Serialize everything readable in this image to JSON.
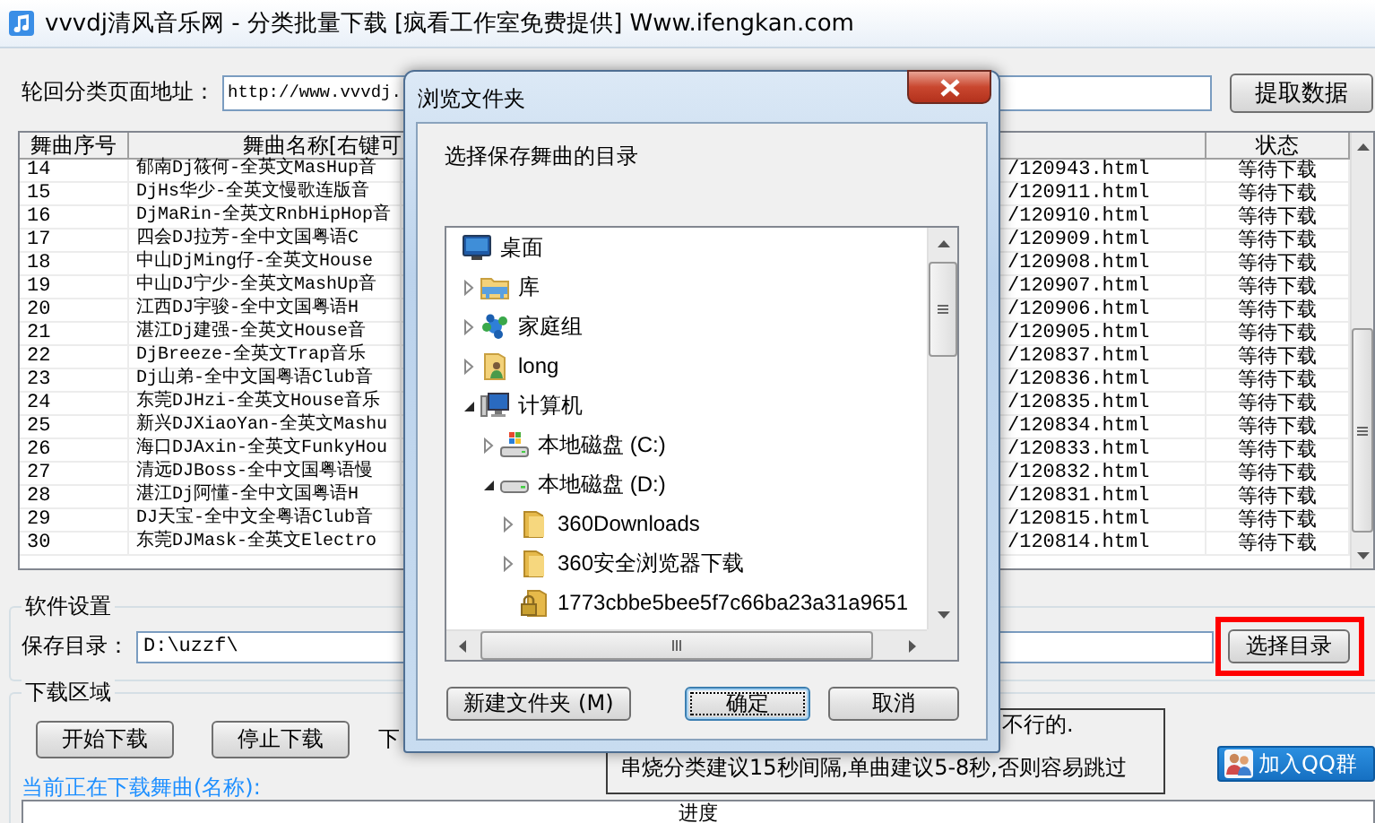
{
  "window": {
    "title": "vvvdj清风音乐网 - 分类批量下载 [疯看工作室免费提供] Www.ifengkan.com"
  },
  "url_row": {
    "label": "轮回分类页面地址：",
    "value": "http://www.vvvdj.",
    "button": "提取数据"
  },
  "song_table": {
    "columns": [
      "舞曲序号",
      "舞曲名称[右键可",
      "状态"
    ],
    "rows": [
      {
        "number": "14",
        "name": "郁南Dj筱何-全英文MasHup音",
        "column_3": "/120943.html",
        "status": "等待下载"
      },
      {
        "number": "15",
        "name": "DjHs华少-全英文慢歌连版音",
        "column_3": "/120911.html",
        "status": "等待下载"
      },
      {
        "number": "16",
        "name": "DjMaRin-全英文RnbHipHop音",
        "column_3": "/120910.html",
        "status": "等待下载"
      },
      {
        "number": "17",
        "name": "四会DJ拉芳-全中文国粤语C",
        "column_3": "/120909.html",
        "status": "等待下载"
      },
      {
        "number": "18",
        "name": "中山DjMing仔-全英文House",
        "column_3": "/120908.html",
        "status": "等待下载"
      },
      {
        "number": "19",
        "name": "中山DJ宁少-全英文MashUp音",
        "column_3": "/120907.html",
        "status": "等待下载"
      },
      {
        "number": "20",
        "name": "江西DJ宇骏-全中文国粤语H",
        "column_3": "/120906.html",
        "status": "等待下载"
      },
      {
        "number": "21",
        "name": "湛江Dj建强-全英文House音",
        "column_3": "/120905.html",
        "status": "等待下载"
      },
      {
        "number": "22",
        "name": "DjBreeze-全英文Trap音乐",
        "column_3": "/120837.html",
        "status": "等待下载"
      },
      {
        "number": "23",
        "name": "Dj山弟-全中文国粤语Club音",
        "column_3": "/120836.html",
        "status": "等待下载"
      },
      {
        "number": "24",
        "name": "东莞DJHzi-全英文House音乐",
        "column_3": "/120835.html",
        "status": "等待下载"
      },
      {
        "number": "25",
        "name": "新兴DJXiaoYan-全英文Mashu",
        "column_3": "/120834.html",
        "status": "等待下载"
      },
      {
        "number": "26",
        "name": "海口DJAxin-全英文FunkyHou",
        "column_3": "/120833.html",
        "status": "等待下载"
      },
      {
        "number": "27",
        "name": "清远DJBoss-全中文国粤语慢",
        "column_3": "/120832.html",
        "status": "等待下载"
      },
      {
        "number": "28",
        "name": "湛江Dj阿懂-全中文国粤语H",
        "column_3": "/120831.html",
        "status": "等待下载"
      },
      {
        "number": "29",
        "name": "DJ天宝-全中文全粤语Club音",
        "column_3": "/120815.html",
        "status": "等待下载"
      },
      {
        "number": "30",
        "name": "东莞DJMask-全英文Electro",
        "column_3": "/120814.html",
        "status": "等待下载"
      }
    ]
  },
  "settings": {
    "title": "软件设置",
    "label": "保存目录：",
    "value": "D:\\uzzf\\",
    "button": {
      "label": "选择目录",
      "highlighted": true
    }
  },
  "download": {
    "title": "下载区域",
    "buttons": [
      "开始下载",
      "停止下载"
    ],
    "cut_label": "下",
    "notice": [
      "不行的.",
      "串烧分类建议15秒间隔,单曲建议5-8秒,否则容易跳过"
    ],
    "current_label": "当前正在下载舞曲(名称):",
    "qq_button": "加入QQ群",
    "progress_column": "进度"
  },
  "dialog": {
    "title": "浏览文件夹",
    "prompt": "选择保存舞曲的目录",
    "tree": [
      {
        "label": "桌面",
        "kind": "desktop",
        "children": [
          {
            "label": "库",
            "kind": "library",
            "expanded": false
          },
          {
            "label": "家庭组",
            "kind": "homegroup",
            "expanded": false
          },
          {
            "label": "long",
            "kind": "user",
            "expanded": false
          },
          {
            "label": "计算机",
            "kind": "computer",
            "expanded": true,
            "children": [
              {
                "label": "本地磁盘 (C:)",
                "kind": "system_drive",
                "expanded": false
              },
              {
                "label": "本地磁盘 (D:)",
                "kind": "drive",
                "expanded": true,
                "children": [
                  {
                    "label": "360Downloads",
                    "kind": "folder",
                    "expanded": false
                  },
                  {
                    "label": "360安全浏览器下载",
                    "kind": "folder",
                    "expanded": false
                  },
                  {
                    "label": "1773cbbe5bee5f7c66ba23a31a9651",
                    "kind": "locked_folder"
                  }
                ]
              }
            ]
          }
        ]
      }
    ],
    "buttons": [
      {
        "label": "新建文件夹 (M)",
        "focused": false
      },
      {
        "label": "确定",
        "focused": true
      },
      {
        "label": "取消",
        "focused": false
      }
    ]
  }
}
